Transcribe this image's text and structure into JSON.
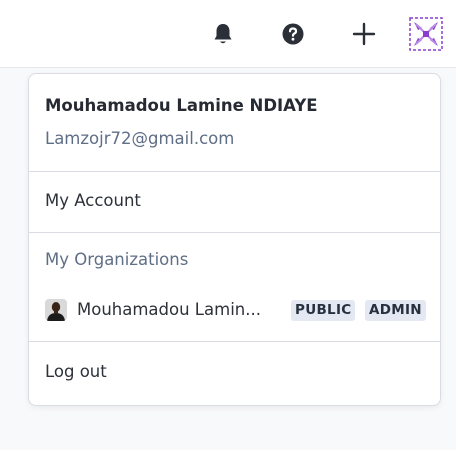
{
  "header": {
    "icons": [
      "bell-icon",
      "help-icon",
      "plus-icon",
      "user-avatar-icon"
    ]
  },
  "menu": {
    "user": {
      "name": "Mouhamadou Lamine NDIAYE",
      "email": "Lamzojr72@gmail.com"
    },
    "my_account_label": "My Account",
    "organizations_header": "My Organizations",
    "organizations": [
      {
        "name": "Mouhamadou Lamin...",
        "badges": [
          "PUBLIC",
          "ADMIN"
        ]
      }
    ],
    "logout_label": "Log out"
  },
  "colors": {
    "accent_avatar": "#8a3ecf",
    "badge_bg": "#e3e8f2",
    "muted_text": "#5f6e87"
  }
}
